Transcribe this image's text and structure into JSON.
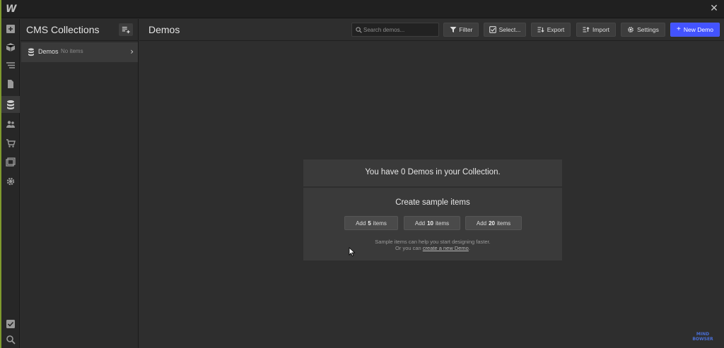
{
  "app": {
    "logo_letter": "W"
  },
  "sidebar_panel": {
    "title": "CMS Collections",
    "collections": [
      {
        "name": "Demos",
        "status": "No items"
      }
    ]
  },
  "main": {
    "title": "Demos",
    "search_placeholder": "Search demos...",
    "toolbar": {
      "filter": "Filter",
      "select": "Select...",
      "export": "Export",
      "import": "Import",
      "settings": "Settings",
      "new_item": "New Demo"
    },
    "empty_state": {
      "message": "You have 0 Demos in your Collection.",
      "sample_heading": "Create sample items",
      "buttons": [
        {
          "prefix": "Add",
          "count": "5",
          "suffix": "items"
        },
        {
          "prefix": "Add",
          "count": "10",
          "suffix": "items"
        },
        {
          "prefix": "Add",
          "count": "20",
          "suffix": "items"
        }
      ],
      "note_line1": "Sample items can help you start designing faster.",
      "note_line2_prefix": "Or you can",
      "note_link": "create a new Demo",
      "note_line2_suffix": "."
    }
  },
  "watermark": {
    "line1": "MIND",
    "line2": "BOWSER"
  },
  "colors": {
    "accent": "#4353ff",
    "edge": "#7f9b2e",
    "background": "#2e2e2e"
  },
  "icons": [
    "add-element-icon",
    "box-icon",
    "navigator-icon",
    "pages-icon",
    "cms-database-icon",
    "users-icon",
    "cart-icon",
    "assets-icon",
    "settings-gear-icon",
    "checkbox-icon",
    "search-icon"
  ]
}
